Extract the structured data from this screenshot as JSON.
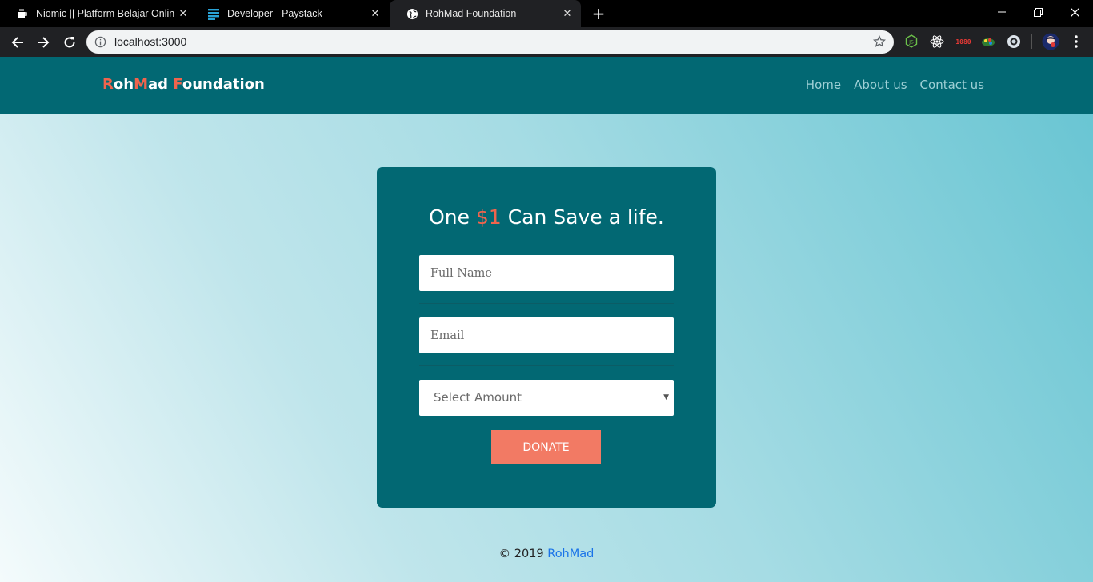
{
  "browser": {
    "tabs": [
      {
        "title": "Niomic || Platform Belajar Online",
        "icon": "niomic-favicon"
      },
      {
        "title": "Developer - Paystack",
        "icon": "paystack-favicon"
      },
      {
        "title": "RohMad Foundation",
        "icon": "globe-favicon"
      }
    ],
    "url": "localhost:3000",
    "ext_badge": "1080"
  },
  "site": {
    "brand": {
      "r": "R",
      "oh": "oh",
      "m": "M",
      "ad": "ad ",
      "f": "F",
      "oundation": "oundation"
    },
    "nav": [
      "Home",
      "About us",
      "Contact us"
    ]
  },
  "form": {
    "heading_pre": "One ",
    "heading_money": "$1",
    "heading_post": " Can Save a life.",
    "name_placeholder": "Full Name",
    "email_placeholder": "Email",
    "amount_selected": "Select Amount",
    "donate_label": "DONATE"
  },
  "footer": {
    "copyright": "© 2019 ",
    "author": "RohMad"
  },
  "colors": {
    "navbar": "#026873",
    "accent": "#f0644d",
    "button": "#f27a64",
    "link": "#1a73e8"
  }
}
